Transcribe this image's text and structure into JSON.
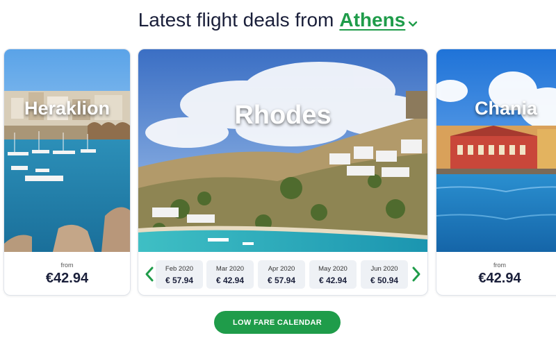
{
  "headline": {
    "prefix": "Latest flight deals from",
    "city": "Athens"
  },
  "cards": {
    "heraklion": {
      "city": "Heraklion",
      "from_label": "from",
      "price": "€42.94"
    },
    "rhodes": {
      "city": "Rhodes",
      "months": [
        {
          "label": "Feb 2020",
          "price": "€ 57.94"
        },
        {
          "label": "Mar 2020",
          "price": "€ 42.94"
        },
        {
          "label": "Apr 2020",
          "price": "€ 57.94"
        },
        {
          "label": "May 2020",
          "price": "€ 42.94"
        },
        {
          "label": "Jun 2020",
          "price": "€ 50.94"
        }
      ]
    },
    "chania": {
      "city": "Chania",
      "from_label": "from",
      "price": "€42.94"
    }
  },
  "cta": {
    "label": "LOW FARE CALENDAR"
  },
  "colors": {
    "accent_green": "#1f9c4a",
    "text_dark": "#1a1f3a",
    "tile_bg": "#eef1f5"
  },
  "icons": {
    "city_dropdown": "chevron-down-icon",
    "prev": "chevron-left-icon",
    "next": "chevron-right-icon"
  }
}
